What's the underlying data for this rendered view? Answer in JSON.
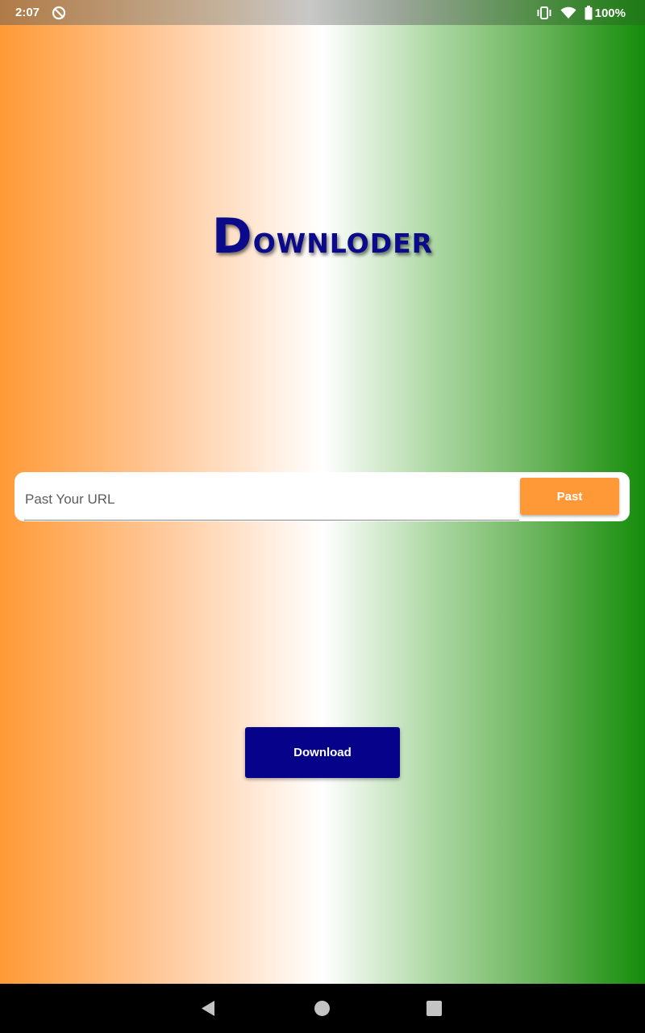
{
  "status_bar": {
    "time": "2:07",
    "battery_text": "100%",
    "icons": [
      "sync-off-icon",
      "vibrate-icon",
      "wifi-icon",
      "battery-icon"
    ]
  },
  "title": {
    "first_letter": "D",
    "rest": "ownloder"
  },
  "url_input": {
    "value": "",
    "placeholder": "Past Your URL"
  },
  "paste_button": {
    "label": "Past"
  },
  "download_button": {
    "label": "Download"
  },
  "nav_bar": {
    "icons": [
      "back-icon",
      "home-icon",
      "recents-icon"
    ]
  },
  "colors": {
    "saffron": "#ff9836",
    "white": "#ffffff",
    "green": "#148c0a",
    "navy": "#06038a"
  }
}
